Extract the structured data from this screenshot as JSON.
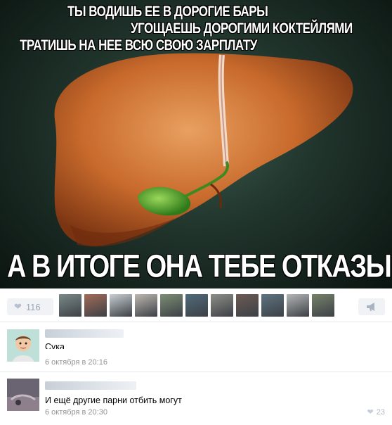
{
  "post": {
    "meme": {
      "caption_line1": "ТЫ ВОДИШЬ ЕЕ В ДОРОГИЕ БАРЫ",
      "caption_line2": "УГОЩАЕШЬ ДОРОГИМИ КОКТЕЙЛЯМИ",
      "caption_line3": "ТРАТИШЬ НА НЕЕ ВСЮ СВОЮ ЗАРПЛАТУ",
      "caption_bottom": "А В ИТОГЕ ОНА ТЕБЕ ОТКАЗЫВАЕТ"
    },
    "likes": {
      "icon": "heart-icon",
      "count": "116",
      "liker_colors": [
        "#7b8a88",
        "#a26c58",
        "#c9cfd2",
        "#bdb8b0",
        "#7d8e74",
        "#4f6b7a",
        "#8c8f86",
        "#6d5b54",
        "#5e7480",
        "#b4b7b6",
        "#78826a"
      ]
    },
    "share": {
      "icon": "megaphone-icon"
    }
  },
  "comments": [
    {
      "text": "Сука",
      "date": "6 октября в 20:16",
      "avatar_icon": "baby-cartoon-avatar"
    },
    {
      "text": "И ещё другие парни отбить могут",
      "date": "6 октября в 20:30",
      "likes": "23",
      "like_icon": "heart-icon",
      "avatar_icon": "user-photo-avatar"
    }
  ],
  "colors": {
    "accent_text": "#939393",
    "button_bg": "#f0f2f5",
    "divider": "#e7e8ec"
  }
}
